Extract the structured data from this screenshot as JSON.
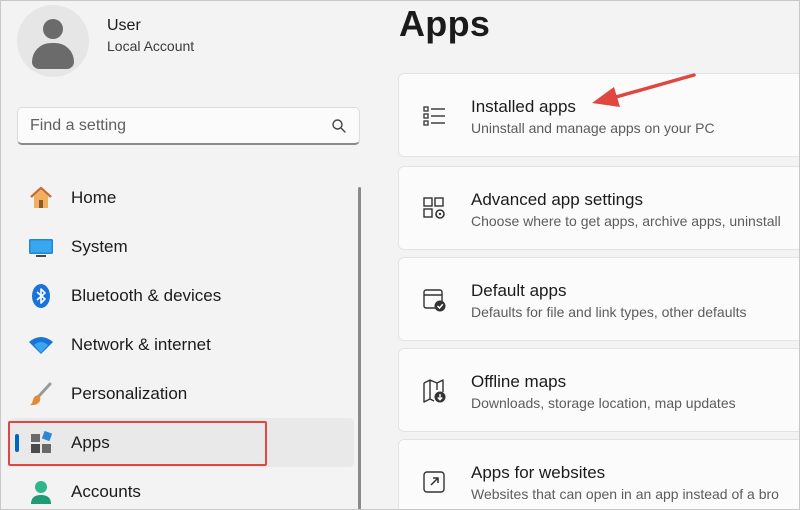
{
  "user": {
    "name": "User",
    "account_type": "Local Account"
  },
  "search": {
    "placeholder": "Find a setting"
  },
  "nav": {
    "items": [
      {
        "label": "Home",
        "icon": "home-icon"
      },
      {
        "label": "System",
        "icon": "system-icon"
      },
      {
        "label": "Bluetooth & devices",
        "icon": "bluetooth-icon"
      },
      {
        "label": "Network & internet",
        "icon": "wifi-icon"
      },
      {
        "label": "Personalization",
        "icon": "brush-icon"
      },
      {
        "label": "Apps",
        "icon": "apps-icon",
        "selected": true
      },
      {
        "label": "Accounts",
        "icon": "accounts-icon"
      }
    ]
  },
  "page": {
    "title": "Apps"
  },
  "cards": [
    {
      "title": "Installed apps",
      "subtitle": "Uninstall and manage apps on your PC",
      "icon": "list-icon"
    },
    {
      "title": "Advanced app settings",
      "subtitle": "Choose where to get apps, archive apps, uninstall",
      "icon": "advanced-settings-icon"
    },
    {
      "title": "Default apps",
      "subtitle": "Defaults for file and link types, other defaults",
      "icon": "default-apps-icon"
    },
    {
      "title": "Offline maps",
      "subtitle": "Downloads, storage location, map updates",
      "icon": "map-icon"
    },
    {
      "title": "Apps for websites",
      "subtitle": "Websites that can open in an app instead of a bro",
      "icon": "open-external-icon"
    }
  ],
  "colors": {
    "accent": "#0067c0",
    "annotation": "#e0473f"
  }
}
